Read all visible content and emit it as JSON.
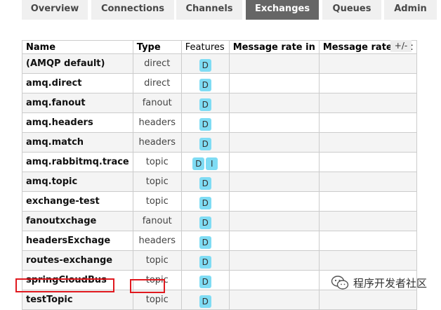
{
  "nav": {
    "tabs": [
      {
        "label": "Overview"
      },
      {
        "label": "Connections"
      },
      {
        "label": "Channels"
      },
      {
        "label": "Exchanges",
        "active": true
      },
      {
        "label": "Queues"
      },
      {
        "label": "Admin"
      }
    ]
  },
  "table": {
    "headers": {
      "name": "Name",
      "type": "Type",
      "features": "Features",
      "rate_in": "Message rate in",
      "rate_out": "Message rate out"
    },
    "toggle_columns": "+/-",
    "rows": [
      {
        "name": "(AMQP default)",
        "type": "direct",
        "features": [
          "D"
        ]
      },
      {
        "name": "amq.direct",
        "type": "direct",
        "features": [
          "D"
        ]
      },
      {
        "name": "amq.fanout",
        "type": "fanout",
        "features": [
          "D"
        ]
      },
      {
        "name": "amq.headers",
        "type": "headers",
        "features": [
          "D"
        ]
      },
      {
        "name": "amq.match",
        "type": "headers",
        "features": [
          "D"
        ]
      },
      {
        "name": "amq.rabbitmq.trace",
        "type": "topic",
        "features": [
          "D",
          "I"
        ]
      },
      {
        "name": "amq.topic",
        "type": "topic",
        "features": [
          "D"
        ]
      },
      {
        "name": "exchange-test",
        "type": "topic",
        "features": [
          "D"
        ]
      },
      {
        "name": "fanoutxchage",
        "type": "fanout",
        "features": [
          "D"
        ]
      },
      {
        "name": "headersExchage",
        "type": "headers",
        "features": [
          "D"
        ]
      },
      {
        "name": "routes-exchange",
        "type": "topic",
        "features": [
          "D"
        ]
      },
      {
        "name": "springCloudBus",
        "type": "topic",
        "features": [
          "D"
        ]
      },
      {
        "name": "testTopic",
        "type": "topic",
        "features": [
          "D"
        ]
      }
    ]
  },
  "watermark": {
    "text": "程序开发者社区",
    "icon": "wechat-icon"
  },
  "colors": {
    "active_tab": "#666666",
    "badge": "#7fdcf4",
    "highlight": "#e0191f"
  }
}
